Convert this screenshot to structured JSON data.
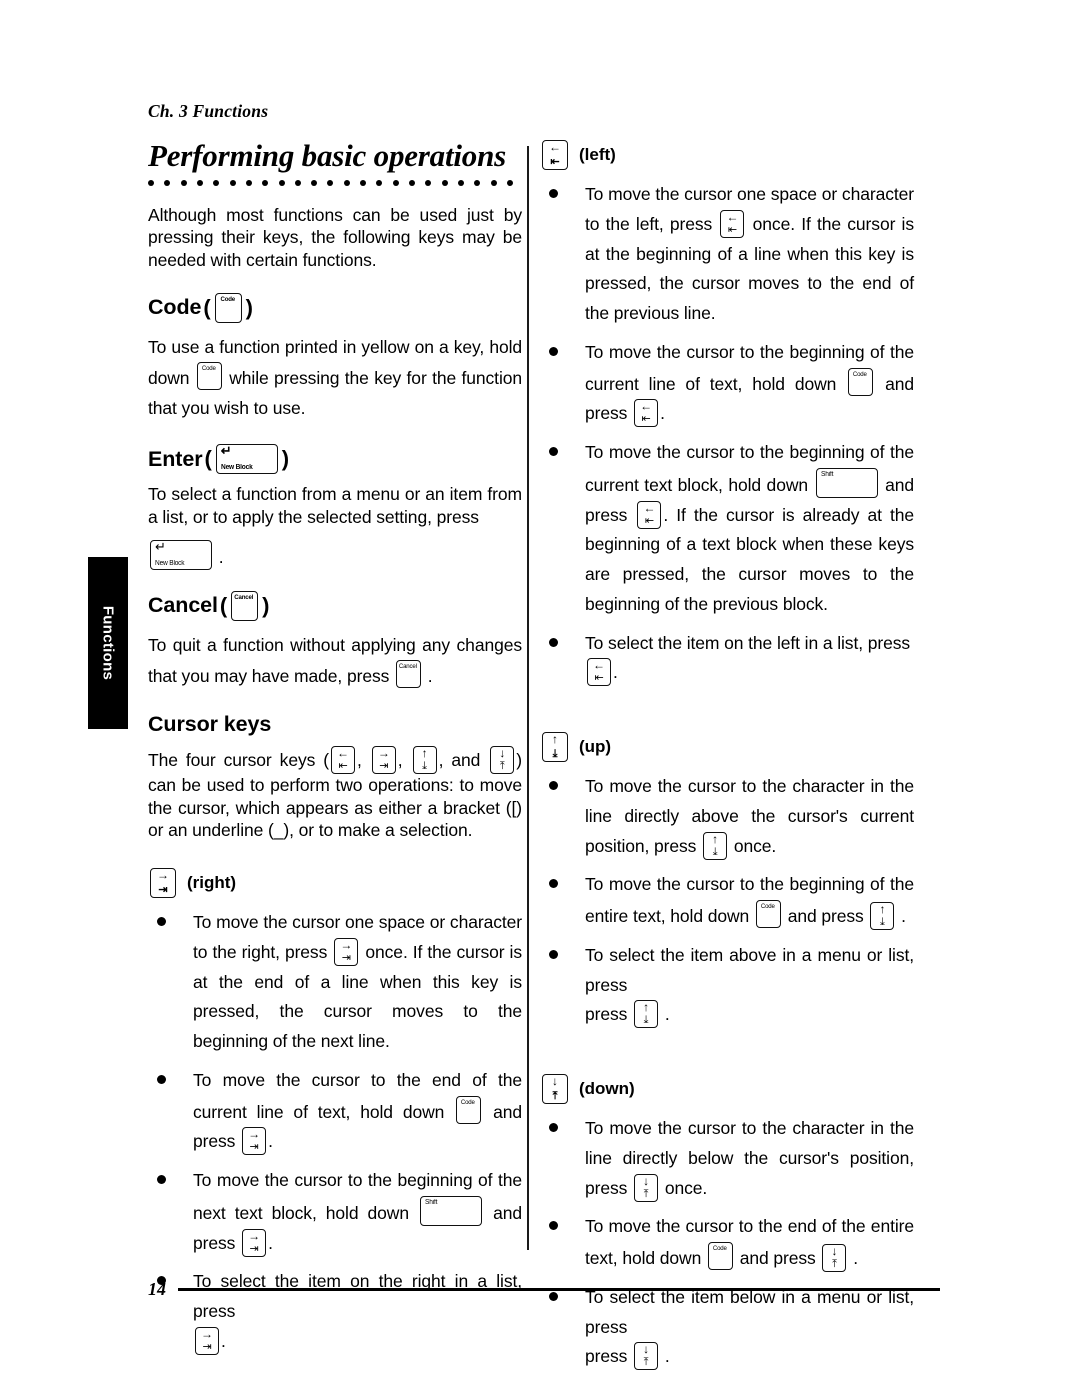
{
  "page": {
    "running_head": "Ch. 3 Functions",
    "folio": "14",
    "side_tab_label": "Functions",
    "dot_count": 23
  },
  "keys": {
    "code": {
      "name": "Code key",
      "cap": "Code"
    },
    "cancel": {
      "name": "Cancel key",
      "cap": "Cancel"
    },
    "enter": {
      "name": "Enter key",
      "arrow": "↵",
      "cap": "New Block"
    },
    "shift": {
      "name": "Shift key",
      "cap": "Shift"
    },
    "left": {
      "name": "Left cursor key",
      "arrow": "←",
      "mark": "⇤"
    },
    "right": {
      "name": "Right cursor key",
      "arrow": "→",
      "mark": "⇥"
    },
    "up": {
      "name": "Up cursor key",
      "arrow": "↑",
      "mark": "⤓"
    },
    "down": {
      "name": "Down cursor key",
      "arrow": "↓",
      "mark": "⤒"
    }
  },
  "left_column": {
    "title": "Performing basic operations",
    "intro": "Although most functions can be used just by pressing their keys, the following keys may be needed with certain functions.",
    "sections": [
      {
        "heading": "Code",
        "body_1": "To use a function printed in yellow on a key,",
        "body_2": "hold down",
        "body_3": "while pressing the key for the function that you wish to use."
      },
      {
        "heading": "Enter",
        "body_1": "To select a function from a menu or an item from a list, or to apply the selected setting, press",
        "body_2": "."
      },
      {
        "heading": "Cancel",
        "body_1": "To quit a function without applying any changes that you may have made, press",
        "body_2": "."
      }
    ],
    "cursor_keys": {
      "heading": "Cursor keys",
      "intro_1": "The four cursor keys (",
      "intro_sep": ",",
      "intro_and": ", and",
      "intro_close": ")",
      "intro_2": "can be used to perform two operations: to move the cursor, which appears as either a bracket ([) or an underline (_), or to make a selection."
    },
    "right_key": {
      "label": "(right)",
      "bullets": [
        {
          "t1": "To move the cursor one space or character to the right, press",
          "t2": "once. If the cursor is at the end of a line when this key is pressed, the cursor moves to the beginning of the next line."
        },
        {
          "t1": "To move the cursor to the end of the current line of text, hold down",
          "t2": "and press",
          "t3": "."
        },
        {
          "t1": "To move the cursor to the beginning of the next text block, hold down",
          "t2": "and press",
          "t3": "."
        },
        {
          "t1": "To select the item on the right in a list, press",
          "t2": "."
        }
      ]
    }
  },
  "right_column": {
    "left_key": {
      "label": "(left)",
      "bullets": [
        {
          "t1": "To move the cursor one space or character to the left, press",
          "t2": "once. If the cursor is at the beginning of a line when this key is pressed, the cursor moves to the end of the previous line."
        },
        {
          "t1": "To move the cursor to the beginning of the current line of text, hold down",
          "t2": "and press",
          "t3": "."
        },
        {
          "t1": "To move the cursor to the beginning of the current text block, hold down",
          "t2": "and press",
          "t3": ". If the cursor is already at the beginning of a text block when these keys are pressed, the cursor moves to the beginning of the previous block."
        },
        {
          "t1": "To select the item on the left in a list, press",
          "t2": "."
        }
      ]
    },
    "up_key": {
      "label": "(up)",
      "bullets": [
        {
          "t1": "To move the cursor to the character in the line directly above the cursor's current position, press",
          "t2": "once."
        },
        {
          "t1": "To move the cursor to the beginning of the entire text, hold down",
          "t2": "and press",
          "t3": "."
        },
        {
          "t1": "To select the item above in a menu or list, press",
          "t2": "."
        }
      ]
    },
    "down_key": {
      "label": "(down)",
      "bullets": [
        {
          "t1": "To move the cursor to the character in the line directly below the cursor's position, press",
          "t2": "once."
        },
        {
          "t1": "To move the cursor to the end of the entire text, hold down",
          "t2": "and press",
          "t3": "."
        },
        {
          "t1": "To select the item below in a menu or list, press",
          "t2": "."
        }
      ]
    }
  }
}
